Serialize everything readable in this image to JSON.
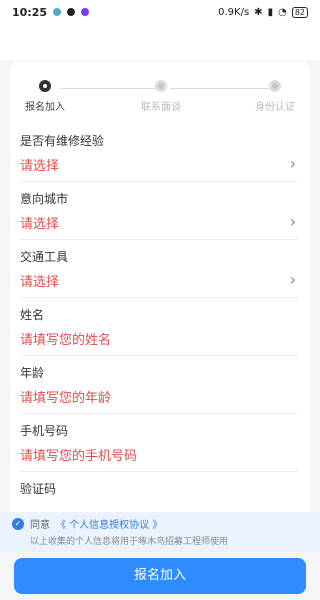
{
  "status_bar": {
    "time": "10:25",
    "network_speed": "0.9K/s",
    "battery": "82"
  },
  "steps": [
    {
      "label": "报名加入",
      "active": true
    },
    {
      "label": "联系面谈",
      "active": false
    },
    {
      "label": "身份认证",
      "active": false
    }
  ],
  "fields": [
    {
      "label": "是否有维修经验",
      "value": "请选择",
      "has_arrow": true
    },
    {
      "label": "意向城市",
      "value": "请选择",
      "has_arrow": true
    },
    {
      "label": "交通工具",
      "value": "请选择",
      "has_arrow": true
    },
    {
      "label": "姓名",
      "value": "请填写您的姓名",
      "has_arrow": false
    },
    {
      "label": "年龄",
      "value": "请填写您的年龄",
      "has_arrow": false
    },
    {
      "label": "手机号码",
      "value": "请填写您的手机号码",
      "has_arrow": false
    },
    {
      "label": "验证码",
      "value": "",
      "has_arrow": false
    }
  ],
  "consent": {
    "prefix": "同意",
    "link": "《 个人信息授权协议 》",
    "note": "以上收集的个人信息将用于啄木鸟招募工程师使用"
  },
  "submit_label": "报名加入",
  "colors": {
    "accent_blue": "#2f8cff",
    "placeholder_red": "#e04e4e"
  }
}
